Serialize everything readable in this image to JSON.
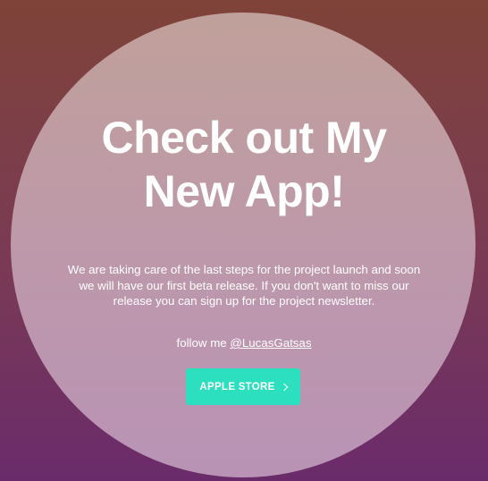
{
  "hero": {
    "headline": "Check out My New App!",
    "description": "We are taking care of the last steps for the project launch and soon we will have our first beta release. If you don't want to miss our release you can sign up for the project newsletter.",
    "follow_prefix": "follow me ",
    "follow_handle": "@LucasGatsas"
  },
  "cta": {
    "label": "APPLE STORE",
    "icon": "chevron-right-icon"
  },
  "colors": {
    "accent": "#2ce0bf",
    "background_top": "#7f4339",
    "background_bottom": "#6a2b6b",
    "circle": "#bd98ab",
    "text": "#ffffff"
  }
}
